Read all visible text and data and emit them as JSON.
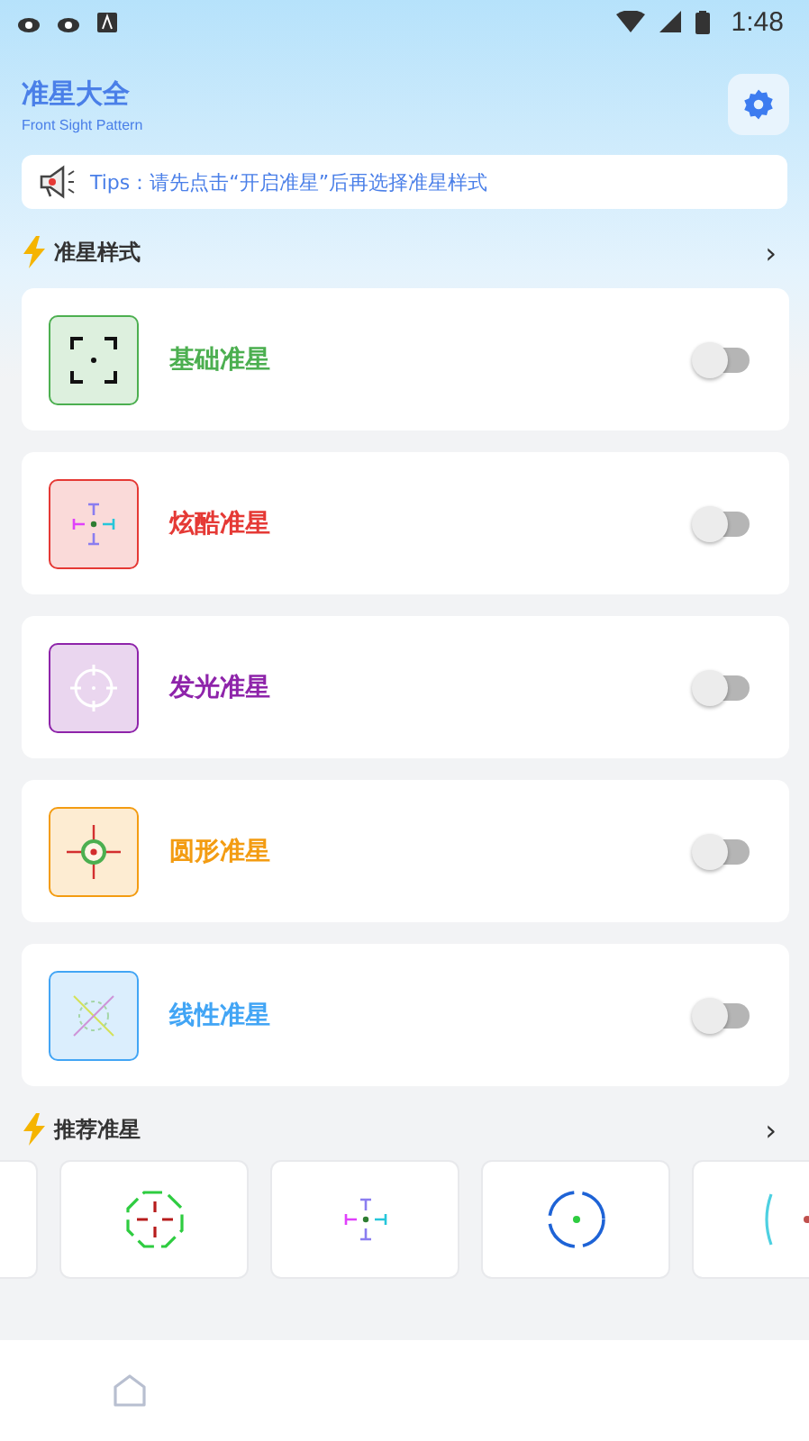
{
  "status_bar": {
    "time": "1:48"
  },
  "header": {
    "title": "准星大全",
    "subtitle": "Front Sight Pattern"
  },
  "tips": {
    "text": "Tips：请先点击“开启准星”后再选择准星样式"
  },
  "styles_section": {
    "title": "准星样式",
    "more": "›"
  },
  "styles": [
    {
      "name": "基础准星",
      "color": "#4caf50",
      "kind": "basic",
      "on": false
    },
    {
      "name": "炫酷准星",
      "color": "#e53935",
      "kind": "cool",
      "on": false
    },
    {
      "name": "发光准星",
      "color": "#8e24aa",
      "kind": "glow",
      "on": false
    },
    {
      "name": "圆形准星",
      "color": "#f39c12",
      "kind": "circle",
      "on": false
    },
    {
      "name": "线性准星",
      "color": "#42a5f5",
      "kind": "linear",
      "on": false
    }
  ],
  "recommended_section": {
    "title": "推荐准星",
    "more": "›"
  },
  "recommended": [
    {
      "kind": "blank"
    },
    {
      "kind": "octagon"
    },
    {
      "kind": "arrows"
    },
    {
      "kind": "ring"
    },
    {
      "kind": "bracket"
    }
  ],
  "bottom_nav": [
    {
      "kind": "home",
      "selected": false
    }
  ]
}
